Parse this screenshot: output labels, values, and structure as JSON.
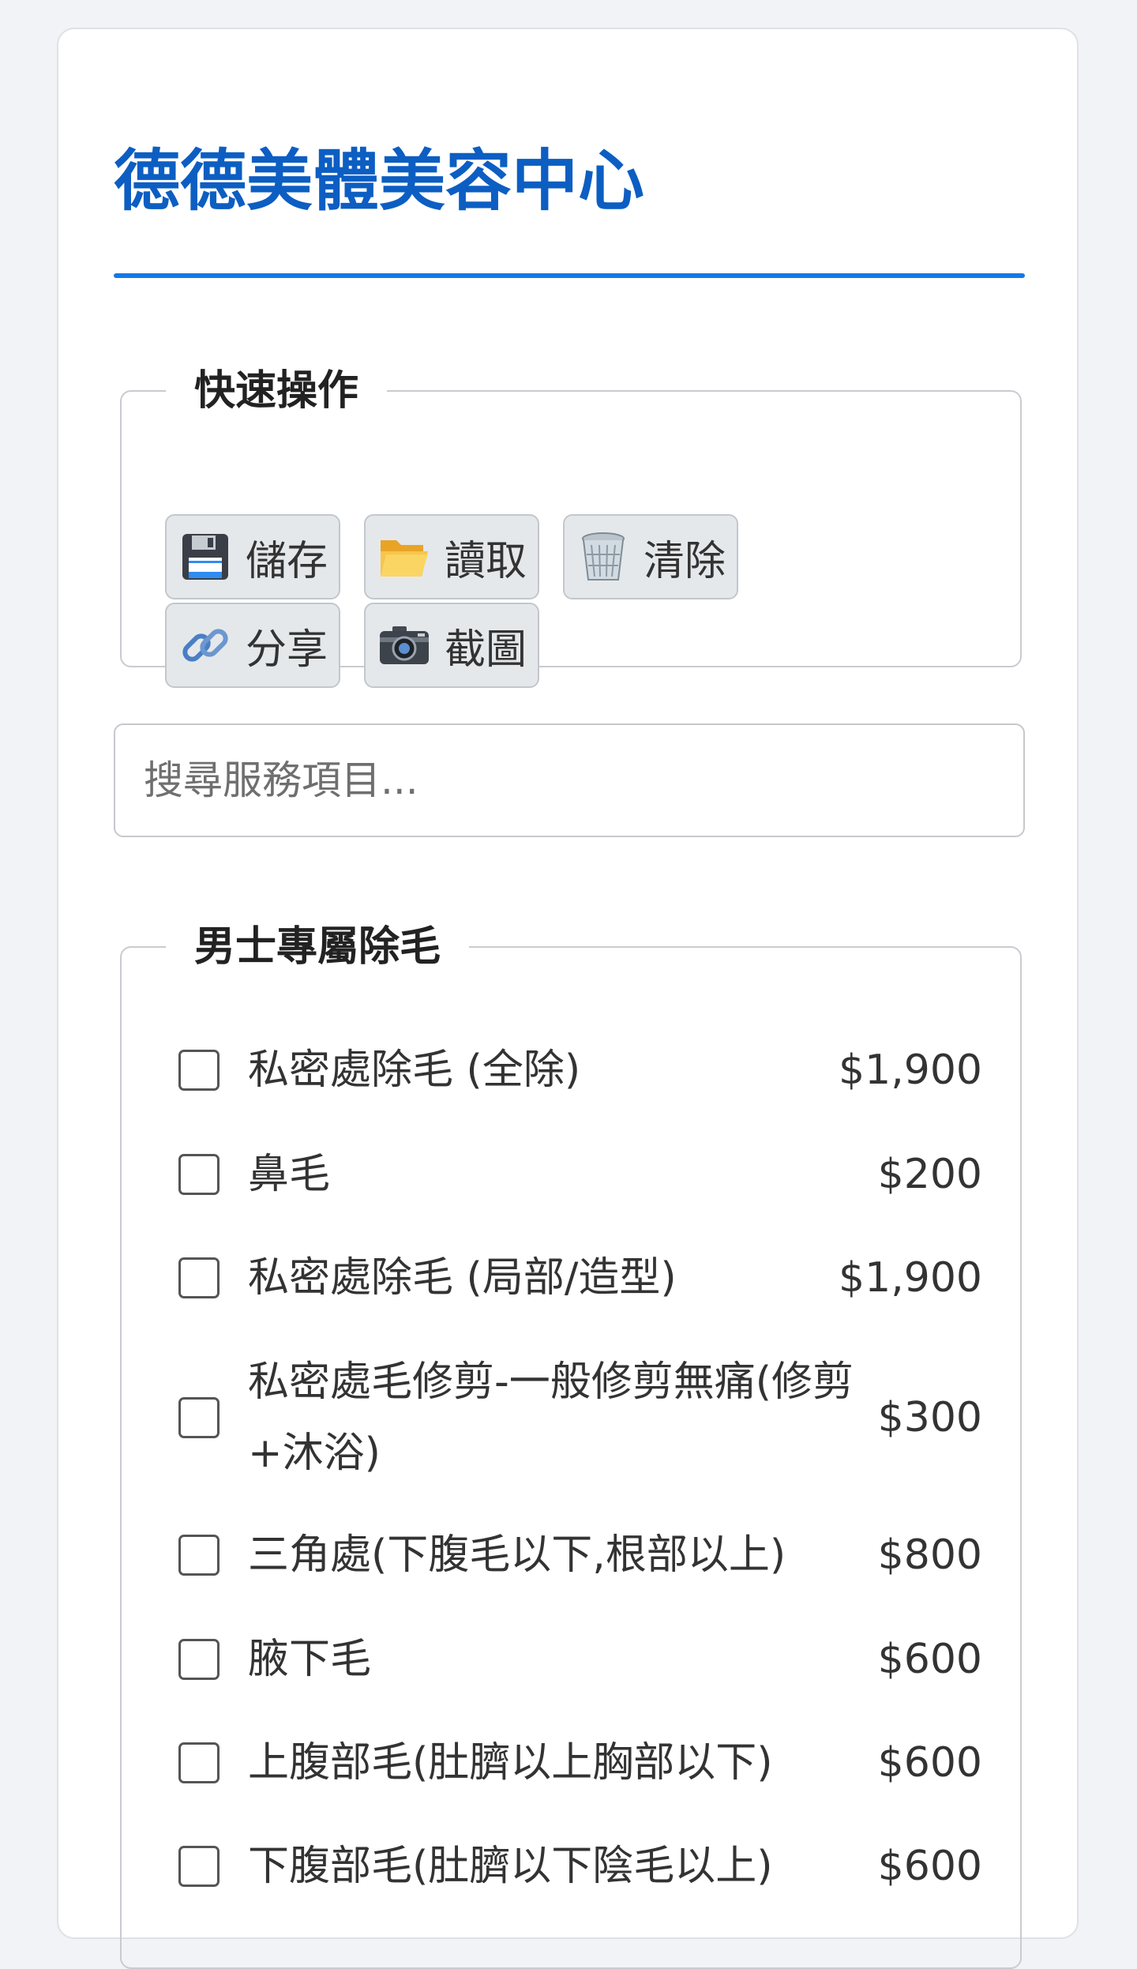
{
  "header": {
    "title": "德德美體美容中心"
  },
  "quick_actions": {
    "legend": "快速操作",
    "buttons": [
      {
        "label": "儲存",
        "icon": "floppy-disk-icon"
      },
      {
        "label": "讀取",
        "icon": "open-folder-icon"
      },
      {
        "label": "清除",
        "icon": "wastebasket-icon"
      },
      {
        "label": "分享",
        "icon": "link-icon"
      },
      {
        "label": "截圖",
        "icon": "camera-icon"
      }
    ]
  },
  "search": {
    "placeholder": "搜尋服務項目..."
  },
  "service_group": {
    "legend": "男士專屬除毛",
    "items": [
      {
        "name": "私密處除毛 (全除)",
        "price": "$1,900"
      },
      {
        "name": "鼻毛",
        "price": "$200"
      },
      {
        "name": "私密處除毛 (局部/造型)",
        "price": "$1,900"
      },
      {
        "name": "私密處毛修剪-一般修剪無痛(修剪+沐浴)",
        "price": "$300"
      },
      {
        "name": "三角處(下腹毛以下,根部以上)",
        "price": "$800"
      },
      {
        "name": "腋下毛",
        "price": "$600"
      },
      {
        "name": "上腹部毛(肚臍以上胸部以下)",
        "price": "$600"
      },
      {
        "name": "下腹部毛(肚臍以下陰毛以上)",
        "price": "$600"
      }
    ]
  },
  "colors": {
    "accent": "#0c5ec2",
    "rule": "#1479e6",
    "background": "#f2f3f7"
  }
}
